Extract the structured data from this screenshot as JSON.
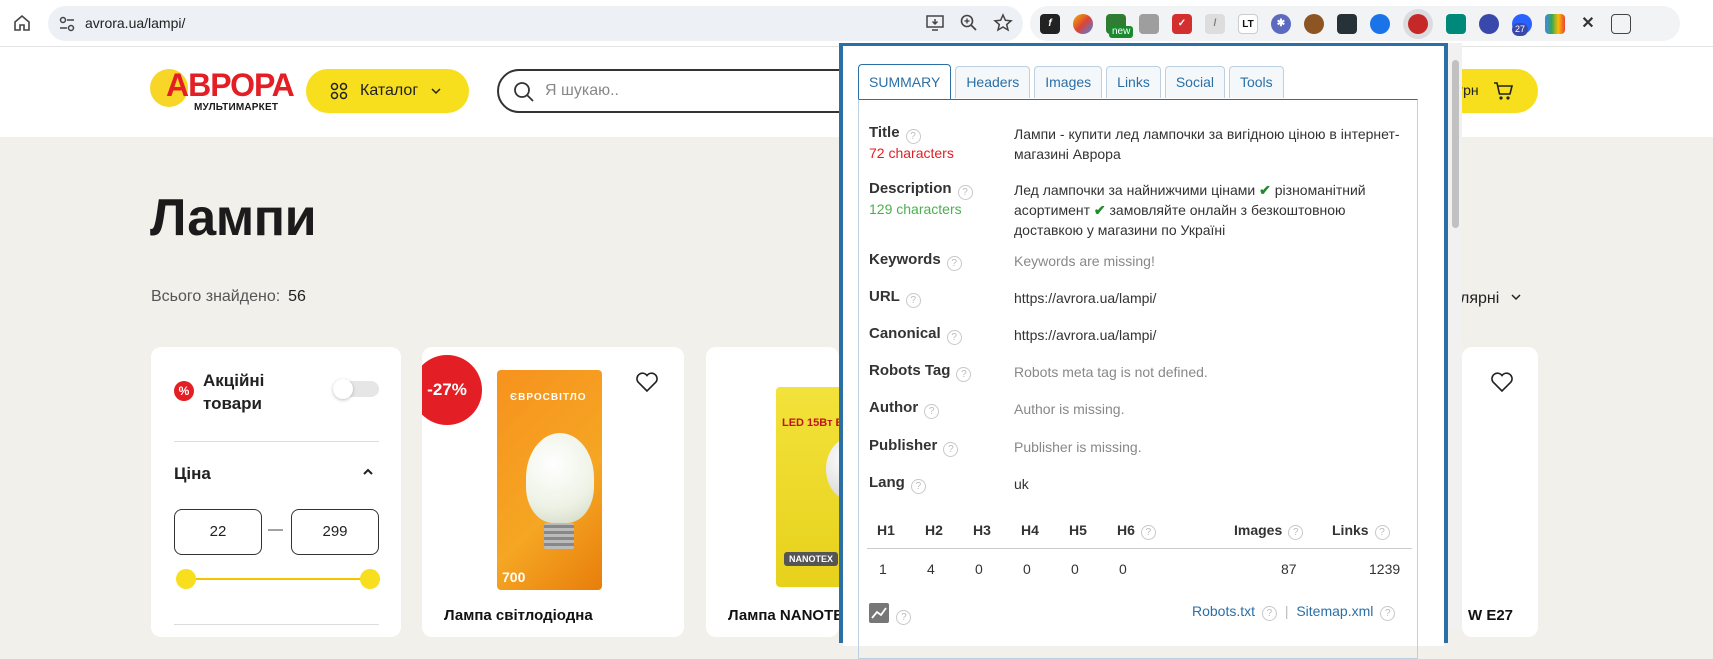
{
  "browser": {
    "url": "avrora.ua/lampi/",
    "ext_badge_new": "new",
    "ext_badge_count": "27"
  },
  "site": {
    "logo_main": "АВРОРА",
    "logo_sub": "МУЛЬТИМАРКЕТ",
    "catalog_label": "Каталог",
    "search_placeholder": "Я шукаю..",
    "cart_label": "грн",
    "page_title": "Лампи",
    "found_label": "Всього знайдено:",
    "found_count": "56",
    "sort_label": "лярні"
  },
  "filters": {
    "promo_badge": "%",
    "promo_label_line1": "Акційні",
    "promo_label_line2": "товари",
    "price_title": "Ціна",
    "price_min": "22",
    "price_max": "299",
    "dash": "—"
  },
  "products": [
    {
      "name": "Лампа світлодіодна",
      "discount": "-27%",
      "box_brand": "ЄВРОСВІТЛО",
      "box_watt": "700"
    },
    {
      "name": "Лампа NANOTE",
      "box_led": "LED 15Вт E27",
      "box_brand": "NANOTEX"
    },
    {
      "name": "W E27"
    }
  ],
  "seo": {
    "tabs": [
      "SUMMARY",
      "Headers",
      "Images",
      "Links",
      "Social",
      "Tools"
    ],
    "title_label": "Title",
    "title_chars": "72 characters",
    "title_value": "Лампи - купити лед лампочки за вигідною ціною в інтернет-магазині Аврора",
    "desc_label": "Description",
    "desc_chars": "129 characters",
    "desc_value_1": "Лед лампочки за найнижчими цінами",
    "desc_value_2": "різноманітний асортимент",
    "desc_value_3": "замовляйте онлайн з безкоштовною доставкою у магазини по Україні",
    "keywords_label": "Keywords",
    "keywords_value": "Keywords are missing!",
    "url_label": "URL",
    "url_value": "https://avrora.ua/lampi/",
    "canonical_label": "Canonical",
    "canonical_value": "https://avrora.ua/lampi/",
    "robots_label": "Robots Tag",
    "robots_value": "Robots meta tag is not defined.",
    "author_label": "Author",
    "author_value": "Author is missing.",
    "publisher_label": "Publisher",
    "publisher_value": "Publisher is missing.",
    "lang_label": "Lang",
    "lang_value": "uk",
    "headings": [
      "H1",
      "H2",
      "H3",
      "H4",
      "H5",
      "H6"
    ],
    "heading_counts": [
      "1",
      "4",
      "0",
      "0",
      "0",
      "0"
    ],
    "images_label": "Images",
    "images_count": "87",
    "links_label": "Links",
    "links_count": "1239",
    "robots_txt": "Robots.txt",
    "sitemap": "Sitemap.xml",
    "separator": "|",
    "help_glyph": "?",
    "check_glyph": "✔"
  },
  "colors": {
    "accent_yellow": "#f7df1e",
    "brand_red": "#e31e24",
    "seo_blue": "#2b6fa5",
    "chars_warn": "#e31e24",
    "chars_ok": "#4caf50"
  }
}
